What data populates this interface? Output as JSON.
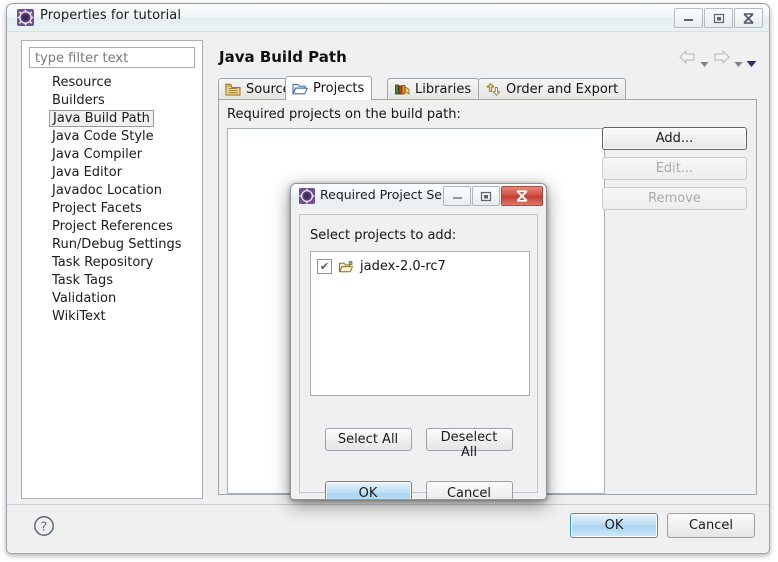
{
  "window": {
    "title": "Properties for tutorial",
    "icon": "properties-gear-icon",
    "minimize_label": "—",
    "maximize_label": "❐",
    "close_label": "✕"
  },
  "sidebar": {
    "filter": {
      "placeholder": "type filter text",
      "value": ""
    },
    "items": [
      {
        "label": "Resource",
        "selected": false
      },
      {
        "label": "Builders",
        "selected": false
      },
      {
        "label": "Java Build Path",
        "selected": true
      },
      {
        "label": "Java Code Style",
        "selected": false
      },
      {
        "label": "Java Compiler",
        "selected": false
      },
      {
        "label": "Java Editor",
        "selected": false
      },
      {
        "label": "Javadoc Location",
        "selected": false
      },
      {
        "label": "Project Facets",
        "selected": false
      },
      {
        "label": "Project References",
        "selected": false
      },
      {
        "label": "Run/Debug Settings",
        "selected": false
      },
      {
        "label": "Task Repository",
        "selected": false
      },
      {
        "label": "Task Tags",
        "selected": false
      },
      {
        "label": "Validation",
        "selected": false
      },
      {
        "label": "WikiText",
        "selected": false
      }
    ]
  },
  "page": {
    "title": "Java Build Path",
    "nav": {
      "back_icon": "back-arrow-icon",
      "back_menu_icon": "chevron-down-icon",
      "forward_icon": "forward-arrow-icon",
      "forward_menu_icon": "chevron-down-icon",
      "menu_icon": "chevron-down-icon"
    },
    "tabs": [
      {
        "label": "Source",
        "icon": "source-package-icon",
        "active": false
      },
      {
        "label": "Projects",
        "icon": "open-folder-icon",
        "active": true
      },
      {
        "label": "Libraries",
        "icon": "books-icon",
        "active": false
      },
      {
        "label": "Order and Export",
        "icon": "order-arrows-icon",
        "active": false
      }
    ],
    "required_label": "Required projects on the build path:",
    "required_projects": [],
    "side_buttons": [
      {
        "label": "Add...",
        "enabled": true,
        "focused": true
      },
      {
        "label": "Edit...",
        "enabled": false,
        "focused": false
      },
      {
        "label": "Remove",
        "enabled": false,
        "focused": false
      }
    ]
  },
  "footer": {
    "help_icon": "help-question-icon",
    "ok_label": "OK",
    "cancel_label": "Cancel"
  },
  "inner_dialog": {
    "title": "Required Project Se...",
    "icon": "properties-gear-icon",
    "minimize_label": "—",
    "maximize_label": "❐",
    "close_label": "✕",
    "select_label": "Select projects to add:",
    "projects": [
      {
        "name": "jadex-2.0-rc7",
        "checked": true,
        "check_glyph": "✔",
        "icon": "open-folder-icon"
      }
    ],
    "select_all_label": "Select All",
    "deselect_all_label": "Deselect All",
    "ok_label": "OK",
    "cancel_label": "Cancel"
  },
  "colors": {
    "window_bg": "#f0f0f0",
    "accent_blue": "#3c8fd0",
    "close_red": "#c03c2e",
    "text": "#141414",
    "disabled_text": "#a8abae"
  }
}
